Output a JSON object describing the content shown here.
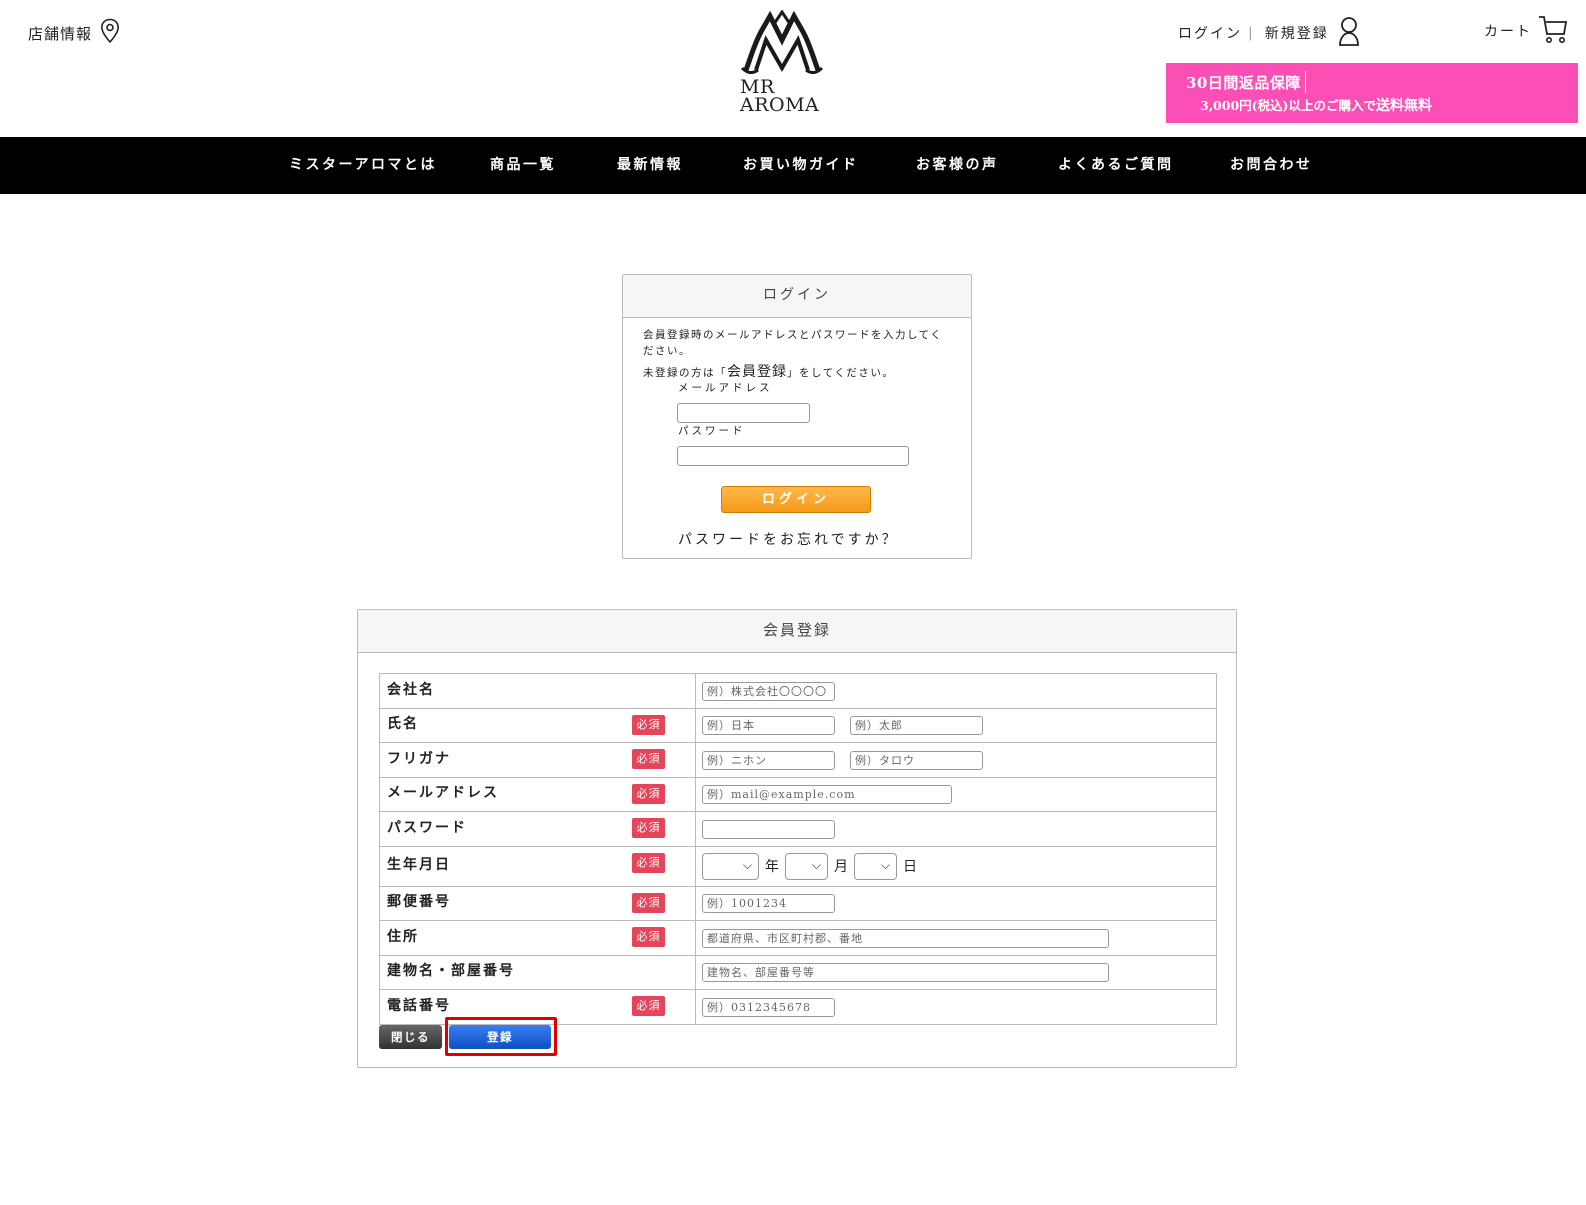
{
  "header": {
    "store_info": "店舗情報",
    "logo_line1": "MR",
    "logo_line2": "AROMA",
    "login": "ログイン",
    "register": "新規登録",
    "cart": "カート",
    "promo_line1": "30日間返品保障",
    "promo_line2_small": "3,000円(税込)以上のご購入で",
    "promo_line2_big": "送料無料"
  },
  "nav": {
    "items": [
      {
        "label": "ミスターアロマとは"
      },
      {
        "label": "商品一覧"
      },
      {
        "label": "最新情報"
      },
      {
        "label": "お買い物ガイド"
      },
      {
        "label": "お客様の声"
      },
      {
        "label": "よくあるご質問"
      },
      {
        "label": "お問合わせ"
      }
    ]
  },
  "login_box": {
    "title": "ログイン",
    "description": "会員登録時のメールアドレスとパスワードを入力してください。",
    "note_prefix": "未登録の方は「",
    "note_link": "会員登録",
    "note_suffix": "」をしてください。",
    "email_label": "メールアドレス",
    "password_label": "パスワード",
    "login_button": "ログイン",
    "forgot": "パスワードをお忘れですか？"
  },
  "register_box": {
    "title": "会員登録",
    "required_badge": "必須",
    "fields": {
      "company": {
        "label": "会社名",
        "placeholder": "例）株式会社〇〇〇〇"
      },
      "name": {
        "label": "氏名",
        "placeholder_last": "例）日本",
        "placeholder_first": "例）太郎"
      },
      "kana": {
        "label": "フリガナ",
        "placeholder_last": "例）ニホン",
        "placeholder_first": "例）タロウ"
      },
      "email": {
        "label": "メールアドレス",
        "placeholder": "例）mail@example.com"
      },
      "password": {
        "label": "パスワード"
      },
      "birthday": {
        "label": "生年月日",
        "year_unit": "年",
        "month_unit": "月",
        "day_unit": "日"
      },
      "zip": {
        "label": "郵便番号",
        "placeholder": "例）1001234"
      },
      "address": {
        "label": "住所",
        "placeholder": "都道府県、市区町村郡、番地"
      },
      "building": {
        "label": "建物名・部屋番号",
        "placeholder": "建物名、部屋番号等"
      },
      "phone": {
        "label": "電話番号",
        "placeholder": "例）0312345678"
      }
    },
    "close_button": "閉じる",
    "register_button": "登録"
  },
  "colors": {
    "promo_bg": "#fb4fb6",
    "nav_bg": "#000000",
    "required_badge": "#e5455a",
    "login_button": "#f59a17",
    "register_button": "#0d4fc4",
    "highlight": "#e00000"
  }
}
